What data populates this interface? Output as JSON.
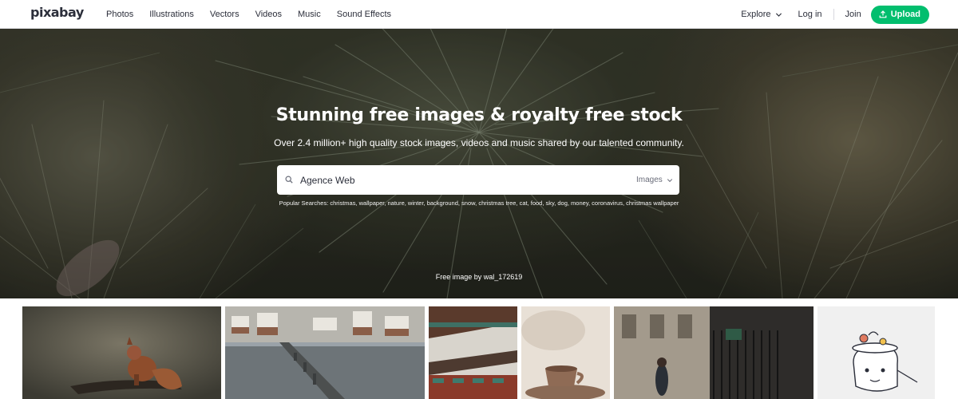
{
  "header": {
    "logo": "pixabay",
    "nav": [
      {
        "label": "Photos"
      },
      {
        "label": "Illustrations"
      },
      {
        "label": "Vectors"
      },
      {
        "label": "Videos"
      },
      {
        "label": "Music"
      },
      {
        "label": "Sound Effects"
      }
    ],
    "explore_label": "Explore",
    "login_label": "Log in",
    "join_label": "Join",
    "upload_label": "Upload"
  },
  "hero": {
    "title": "Stunning free images & royalty free stock",
    "subtitle": "Over 2.4 million+ high quality stock images, videos and music shared by our talented community.",
    "search_value": "Agence Web",
    "search_type": "Images",
    "popular_label": "Popular Searches:",
    "popular_terms": "christmas, wallpaper, nature, winter, background, snow, christmas tree, cat, food, sky, dog, money, coronavirus, christmas wallpaper",
    "credit": "Free image by wal_172619"
  },
  "colors": {
    "accent": "#02be6e",
    "text": "#2b2e3a"
  },
  "grid": {
    "tiles": [
      {
        "icon": "squirrel-photo"
      },
      {
        "icon": "city-bridge-photo"
      },
      {
        "icon": "pagoda-roof-photo"
      },
      {
        "icon": "coffee-cup-photo"
      },
      {
        "icon": "street-gate-photo"
      },
      {
        "icon": "cartoon-illustration"
      }
    ]
  }
}
